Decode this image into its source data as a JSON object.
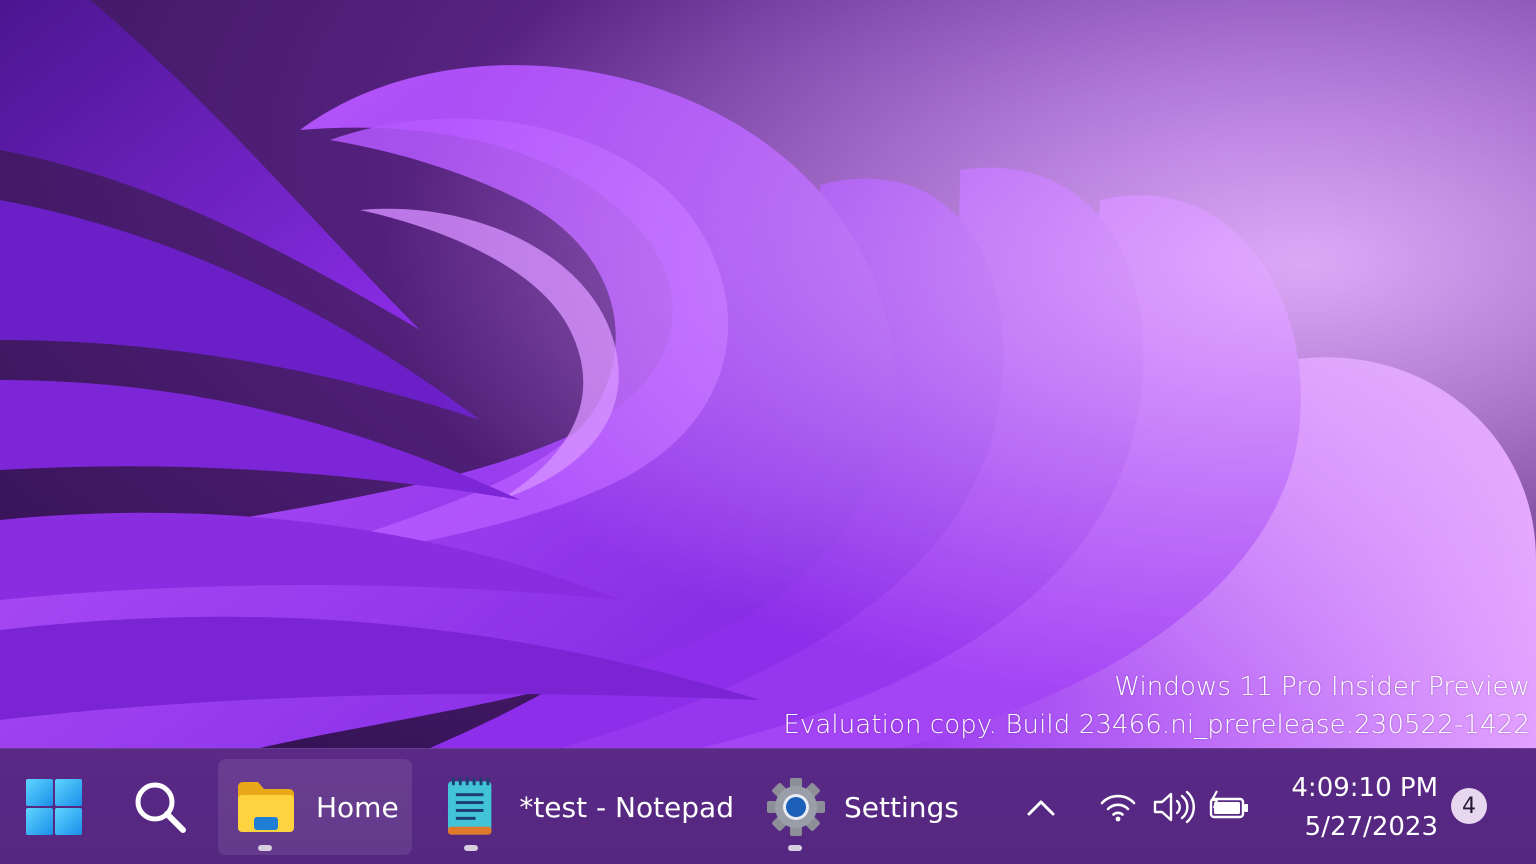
{
  "desktop": {
    "watermark_line1": "Windows 11 Pro Insider Preview",
    "watermark_line2": "Evaluation copy. Build 23466.ni_prerelease.230522-1422"
  },
  "taskbar": {
    "start_icon": "windows-logo-icon",
    "search_icon": "search-icon",
    "apps": [
      {
        "label": "Home",
        "icon": "file-explorer-folder-icon",
        "active": true,
        "running": true
      },
      {
        "label": "*test - Notepad",
        "icon": "notepad-icon",
        "active": false,
        "running": true
      },
      {
        "label": "Settings",
        "icon": "settings-gear-icon",
        "active": false,
        "running": true
      }
    ],
    "tray": {
      "overflow_icon": "chevron-up-icon",
      "wifi_icon": "wifi-icon",
      "volume_icon": "volume-icon",
      "battery_icon": "battery-charging-icon",
      "time": "4:09:10 PM",
      "date": "5/27/2023",
      "notification_count": "4"
    }
  },
  "colors": {
    "taskbar_bg": "#56287f",
    "wallpaper_primary": "#8a2be2",
    "wallpaper_highlight": "#c77dff"
  }
}
